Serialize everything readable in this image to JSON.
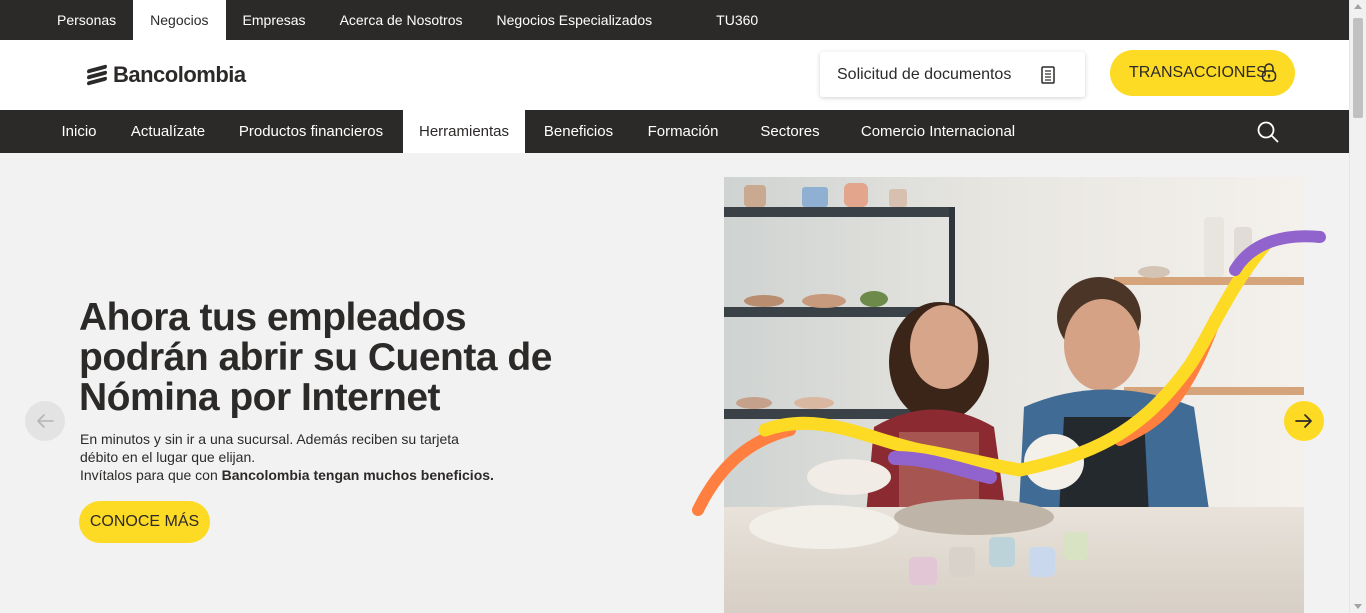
{
  "topbar": {
    "tabs": [
      {
        "label": "Personas",
        "active": false
      },
      {
        "label": "Negocios",
        "active": true
      },
      {
        "label": "Empresas",
        "active": false
      },
      {
        "label": "Acerca de Nosotros",
        "active": false
      },
      {
        "label": "Negocios Especializados",
        "active": false
      },
      {
        "label": "TU360",
        "active": false
      }
    ]
  },
  "header": {
    "logo_text": "Bancolombia",
    "docs_button": "Solicitud de documentos",
    "docs_icon": "document-icon",
    "transactions_button": "TRANSACCIONES",
    "transactions_icon": "lock-icon"
  },
  "mainnav": {
    "items": [
      {
        "label": "Inicio",
        "active": false
      },
      {
        "label": "Actualízate",
        "active": false
      },
      {
        "label": "Productos financieros",
        "active": false
      },
      {
        "label": "Herramientas",
        "active": true
      },
      {
        "label": "Beneficios",
        "active": false
      },
      {
        "label": "Formación",
        "active": false
      },
      {
        "label": "Sectores",
        "active": false
      },
      {
        "label": "Comercio Internacional",
        "active": false
      }
    ],
    "search_icon": "search-icon"
  },
  "hero": {
    "title": "Ahora tus empleados podrán abrir su Cuenta de Nómina por Internet",
    "desc_line1": "En minutos y sin ir a una sucursal. Además reciben su tarjeta",
    "desc_line2": "débito en el lugar que elijan.",
    "desc_line3_prefix": "Invítalos para que con ",
    "desc_line3_bold": "Bancolombia tengan muchos beneficios.",
    "cta": "CONOCE MÁS",
    "prev_icon": "arrow-left-icon",
    "next_icon": "arrow-right-icon"
  },
  "colors": {
    "brand_yellow": "#fdda24",
    "dark": "#2c2a29",
    "background": "#f2f2f2",
    "decor_orange": "#ff7f41",
    "decor_purple": "#9063cd"
  }
}
